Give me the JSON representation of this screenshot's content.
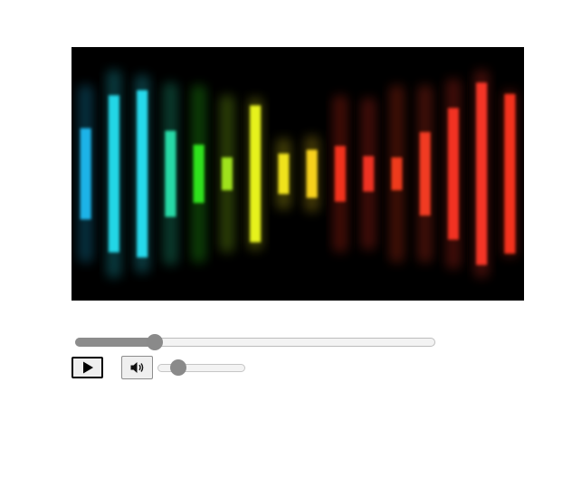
{
  "player": {
    "video": {
      "background": "#000000",
      "bars": [
        {
          "color": "#1fb3e8",
          "level": 0.36,
          "glow": 0.7
        },
        {
          "color": "#23d6e6",
          "level": 0.62,
          "glow": 0.82
        },
        {
          "color": "#25d9ec",
          "level": 0.66,
          "glow": 0.78
        },
        {
          "color": "#28d9a6",
          "level": 0.34,
          "glow": 0.72
        },
        {
          "color": "#2ee21c",
          "level": 0.23,
          "glow": 0.7
        },
        {
          "color": "#9fe21f",
          "level": 0.13,
          "glow": 0.62
        },
        {
          "color": "#e6f21a",
          "level": 0.54,
          "glow": 0.6
        },
        {
          "color": "#f0e21a",
          "level": 0.16,
          "glow": 0.28
        },
        {
          "color": "#f8d11c",
          "level": 0.19,
          "glow": 0.3
        },
        {
          "color": "#f2301e",
          "level": 0.22,
          "glow": 0.62
        },
        {
          "color": "#ef3320",
          "level": 0.14,
          "glow": 0.6
        },
        {
          "color": "#ee3a1f",
          "level": 0.13,
          "glow": 0.7
        },
        {
          "color": "#f13a20",
          "level": 0.33,
          "glow": 0.7
        },
        {
          "color": "#f23220",
          "level": 0.52,
          "glow": 0.75
        },
        {
          "color": "#f53525",
          "level": 0.72,
          "glow": 0.82
        },
        {
          "color": "#f5321f",
          "level": 0.63,
          "glow": 0.66
        }
      ]
    },
    "seek": {
      "progress": 0.22
    },
    "controls": {
      "play_icon": "play-icon",
      "mute_icon": "speaker-icon"
    },
    "volume": {
      "level": 0.24
    }
  }
}
